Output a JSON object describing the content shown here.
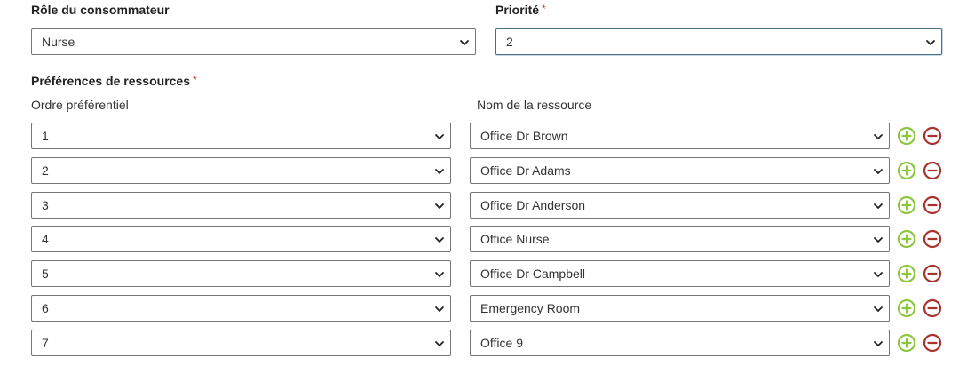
{
  "consumer_role": {
    "label": "Rôle du consommateur",
    "value": "Nurse"
  },
  "priority": {
    "label": "Priorité",
    "required_mark": "*",
    "value": "2"
  },
  "resource_prefs": {
    "label": "Préférences de ressources",
    "required_mark": "*",
    "col_order": "Ordre préférentiel",
    "col_name": "Nom de la ressource",
    "rows": [
      {
        "order": "1",
        "name": "Office Dr Brown"
      },
      {
        "order": "2",
        "name": "Office Dr Adams"
      },
      {
        "order": "3",
        "name": "Office Dr Anderson"
      },
      {
        "order": "4",
        "name": "Office Nurse"
      },
      {
        "order": "5",
        "name": "Office Dr Campbell"
      },
      {
        "order": "6",
        "name": "Emergency Room"
      },
      {
        "order": "7",
        "name": "Office 9"
      }
    ]
  },
  "icons": {
    "add": "plus-circle-icon",
    "remove": "minus-circle-icon",
    "dropdown": "chevron-down-icon"
  },
  "colors": {
    "add": "#8dc63f",
    "remove": "#a8322d",
    "required": "#c0392b"
  }
}
